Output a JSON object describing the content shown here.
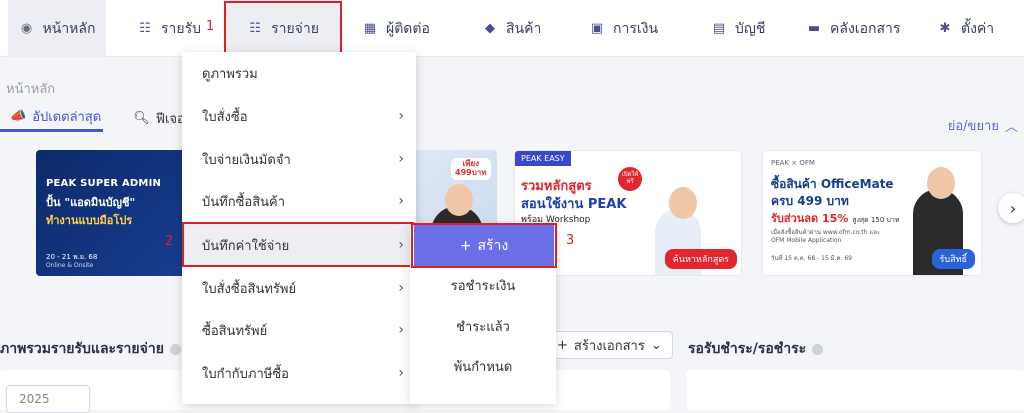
{
  "nav": {
    "home": "หน้าหลัก",
    "income": "รายรับ",
    "expense": "รายจ่าย",
    "contacts": "ผู้ติดต่อ",
    "products": "สินค้า",
    "finance": "การเงิน",
    "accounts": "บัญชี",
    "documents": "คลังเอกสาร",
    "settings": "ตั้งค่า"
  },
  "annotations": {
    "n1": "1",
    "n2": "2",
    "n3": "3"
  },
  "breadcrumb": "หน้าหลัก",
  "tabs": {
    "updates": "อัปเดตล่าสุด",
    "features": "ฟีเจอร์"
  },
  "collapse_label": "ย่อ/ขยาย",
  "banners": {
    "b1": {
      "title": "PEAK SUPER ADMIN",
      "line2": "ปั้น \"แอดมินบัญชี\"",
      "line3": "ทำงานแบบมือโปร",
      "date": "20 - 21 พ.ย. 68",
      "mode": "Online & Onsite"
    },
    "b2": {
      "price_top": "เพียง",
      "price": "499บาท"
    },
    "b3": {
      "tag": "PEAK EASY",
      "badge": "เปิดให้ฟรี",
      "h1": "รวมหลักสูตร",
      "h2": "สอนใช้งาน PEAK",
      "h3": "พร้อม Workshop",
      "btn": "ค้นหาหลักสูตร"
    },
    "b4": {
      "logo": "PEAK × OFM",
      "h1": "ซื้อสินค้า OfficeMate",
      "h2": "ครบ 499 บาท",
      "h3": "รับส่วนลด 15%",
      "h3b": "สูงสุด 150 บาท",
      "h4": "เมื่อสั่งซื้อสินค้าผ่าน www.ofm.co.th และ OFM Mobile Application",
      "h5": "วันที่ 15 ต.ค. 68 - 15 มี.ค. 69",
      "btn": "รับสิทธิ์"
    }
  },
  "sections": {
    "overview": "ภาพรวมรายรับและรายจ่าย",
    "create_doc": "สร้างเอกสาร",
    "pending": "รอรับชำระ/รอชำระ",
    "year": "2025"
  },
  "dropdown": [
    {
      "label": "ดูภาพรวม",
      "chevron": false
    },
    {
      "label": "ใบสั่งซื้อ",
      "chevron": true
    },
    {
      "label": "ใบจ่ายเงินมัดจำ",
      "chevron": true
    },
    {
      "label": "บันทึกซื้อสินค้า",
      "chevron": true
    },
    {
      "label": "บันทึกค่าใช้จ่าย",
      "chevron": true
    },
    {
      "label": "ใบสั่งซื้อสินทรัพย์",
      "chevron": true
    },
    {
      "label": "ซื้อสินทรัพย์",
      "chevron": true
    },
    {
      "label": "ใบกำกับภาษีซื้อ",
      "chevron": true
    }
  ],
  "submenu": {
    "create": "สร้าง",
    "items": [
      "รอชำระเงิน",
      "ชำระแล้ว",
      "พ้นกำหนด"
    ]
  },
  "colors": {
    "accent": "#4a52d6",
    "submenu_create": "#6a6fe8",
    "highlight": "#e02020"
  }
}
